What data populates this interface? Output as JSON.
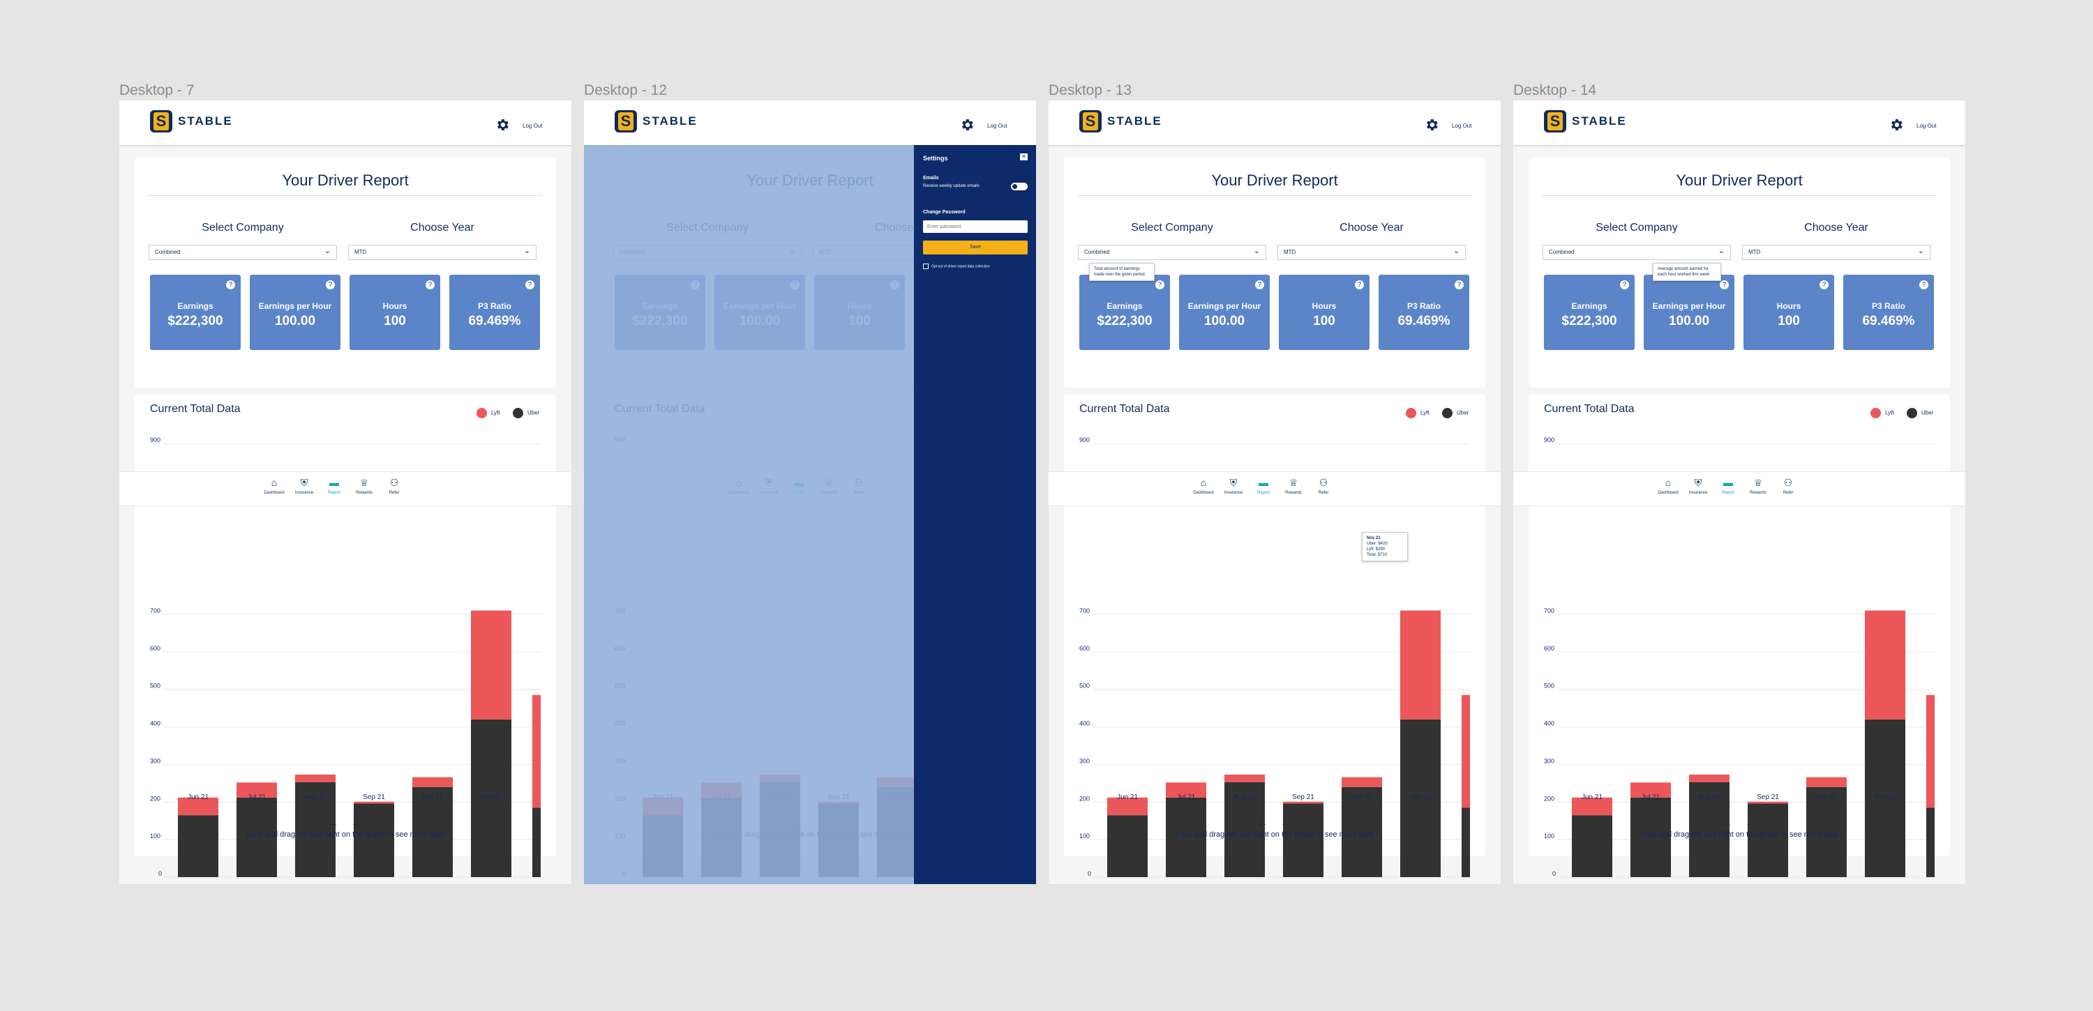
{
  "frames": [
    {
      "label": "Desktop - 7",
      "variant": "base"
    },
    {
      "label": "Desktop - 12",
      "variant": "settings"
    },
    {
      "label": "Desktop - 13",
      "variant": "tooltip-earnings"
    },
    {
      "label": "Desktop - 14",
      "variant": "tooltip-eph"
    }
  ],
  "brand": {
    "name": "STABLE",
    "logo_letter": "S"
  },
  "header": {
    "logout": "Log Out",
    "settings_icon": "gear-icon"
  },
  "report": {
    "title": "Your Driver Report",
    "company_label": "Select Company",
    "year_label": "Choose Year",
    "company_value": "Combined",
    "year_value": "MTD"
  },
  "kpis": [
    {
      "label": "Earnings",
      "value": "$222,300"
    },
    {
      "label": "Earnings per Hour",
      "value": "100.00"
    },
    {
      "label": "Hours",
      "value": "100"
    },
    {
      "label": "P3 Ratio",
      "value": "69.469%"
    }
  ],
  "chart": {
    "title": "Current Total Data",
    "legend": [
      {
        "name": "Lyft",
        "color": "#ec5759"
      },
      {
        "name": "Uber",
        "color": "#323232"
      }
    ],
    "nav_hint": "Click and drag left and right on the graph to see more data",
    "prev_arrow": "←",
    "next_arrow": "→"
  },
  "chart_data": {
    "type": "bar",
    "stacked": true,
    "categories": [
      "Jun 21",
      "Jul 21",
      "Aug 21",
      "Sep 21",
      "Oct 21",
      "Nov 21"
    ],
    "series": [
      {
        "name": "Uber",
        "color": "#323232",
        "values": [
          165,
          212,
          253,
          196,
          240,
          420
        ]
      },
      {
        "name": "Lyft",
        "color": "#ec5759",
        "values": [
          47,
          40,
          20,
          5,
          26,
          290
        ]
      }
    ],
    "partial_next": {
      "uber": 185,
      "lyft": 300
    },
    "y_ticks": [
      "0",
      "100",
      "200",
      "300",
      "400",
      "500",
      "600",
      "700"
    ],
    "y_top_tick": "900",
    "ylim": [
      0,
      700
    ],
    "grid": true,
    "legend_position": "top-right"
  },
  "nav": [
    {
      "label": "Dashboard",
      "icon": "home-icon",
      "glyph": "⌂",
      "active": false
    },
    {
      "label": "Insurance",
      "icon": "shield-icon",
      "glyph": "⛨",
      "active": false
    },
    {
      "label": "Report",
      "icon": "folder-icon",
      "glyph": "▬",
      "active": true
    },
    {
      "label": "Rewards",
      "icon": "trophy-icon",
      "glyph": "♕",
      "active": false
    },
    {
      "label": "Refer",
      "icon": "people-icon",
      "glyph": "⚇",
      "active": false
    }
  ],
  "settings": {
    "title": "Settings",
    "close": "✕",
    "emails_label": "Emails",
    "emails_option": "Receive weekly update emails",
    "password_label": "Change Password",
    "password_placeholder": "Enter password",
    "save": "Save",
    "optout": "Opt out of driver report data collection"
  },
  "tooltips": {
    "earnings": "Total amount of earnings made over the given period",
    "eph": "Average amount earned for each hour worked this week",
    "bar": {
      "month": "Nov 21",
      "uber": "Uber: $420",
      "lyft": "Lyft: $290",
      "total": "Total: $710"
    }
  },
  "colors": {
    "navy": "#0f2a5c",
    "kpi": "#5b84c9",
    "lyft": "#ec5759",
    "uber": "#323232",
    "active_nav": "#1ba89a",
    "accent": "#f4b117"
  }
}
